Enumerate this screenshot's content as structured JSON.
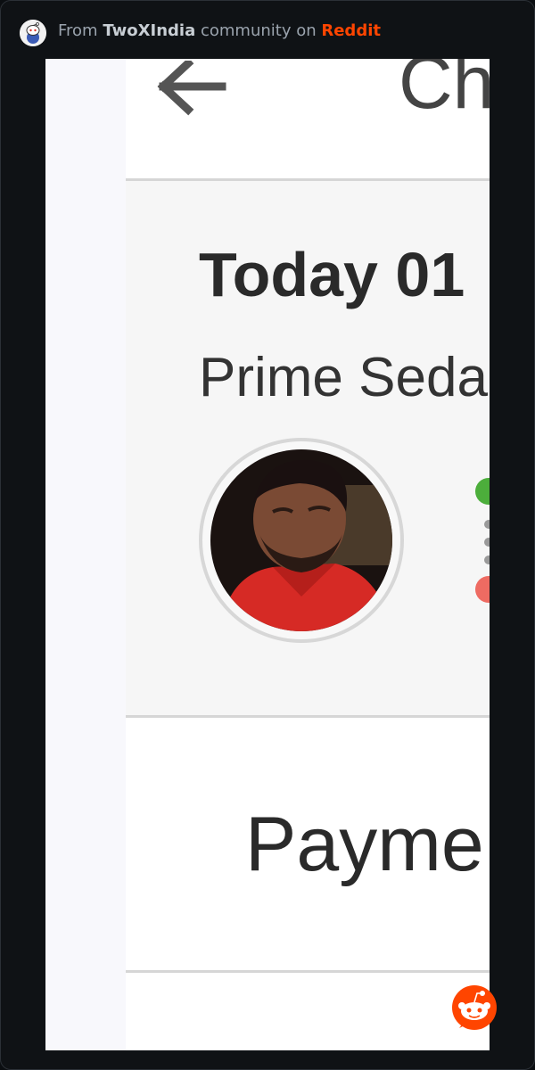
{
  "embed": {
    "prefix": "From",
    "community": "TwoXIndia",
    "middle": "community on",
    "platform": "Reddit",
    "subreddit_icon": "snoo-avatar-icon",
    "platform_badge_icon": "reddit-logo-icon"
  },
  "screenshot": {
    "header": {
      "back_icon": "back-arrow-icon",
      "title": "Ch"
    },
    "ride": {
      "date": "Today 01",
      "vehicle_type": "Prime Seda",
      "driver_photo": "driver-avatar",
      "pickup_marker": "green-dot-icon",
      "drop_marker": "red-dot-icon"
    },
    "payment": {
      "label": "Payme"
    }
  },
  "colors": {
    "background": "#0b0e11",
    "reddit_orange": "#ff4500",
    "pickup_green": "#4cae3b",
    "drop_red": "#ee6b62"
  }
}
